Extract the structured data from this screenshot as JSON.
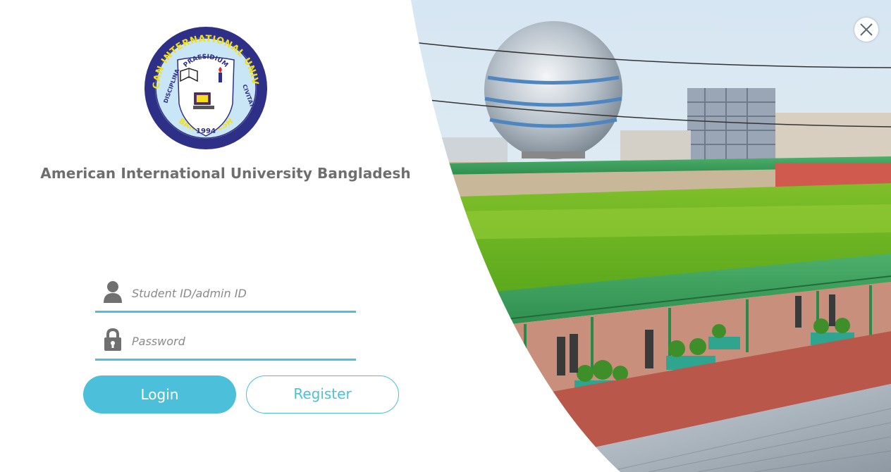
{
  "window": {
    "close_icon": "close-icon"
  },
  "branding": {
    "logo_top_text": "AMERICAN INTERNATIONAL UNIVERSITY",
    "logo_bottom_text": "BANGLADESH",
    "logo_motto_top": "PRAESIDIUM",
    "logo_motto_left": "DISCIPLINA",
    "logo_motto_right": "CIVITATIS",
    "logo_year": "1994",
    "university_name": "American International University Bangladesh"
  },
  "form": {
    "username": {
      "icon": "user-icon",
      "placeholder": "Student ID/admin ID",
      "value": ""
    },
    "password": {
      "icon": "lock-icon",
      "placeholder": "Password",
      "value": ""
    },
    "login_label": "Login",
    "register_label": "Register"
  },
  "colors": {
    "accent": "#4cc0da",
    "title_text": "#6e6e6e",
    "logo_navy": "#2e2f86",
    "logo_yellow": "#f2e01c"
  }
}
